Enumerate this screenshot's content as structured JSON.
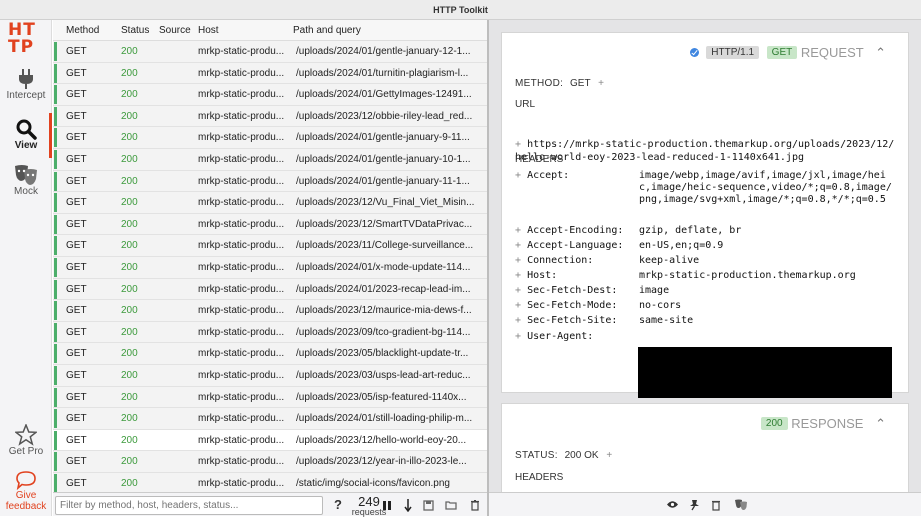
{
  "window": {
    "title": "HTTP Toolkit"
  },
  "app": {
    "logo_line1": "HT",
    "logo_line2": "TP"
  },
  "nav": {
    "intercept": "Intercept",
    "view": "View",
    "mock": "Mock",
    "get_pro": "Get Pro",
    "feedback_line1": "Give",
    "feedback_line2": "feedback"
  },
  "list": {
    "columns": {
      "method": "Method",
      "status": "Status",
      "source": "Source",
      "host": "Host",
      "path": "Path and query"
    },
    "rows": [
      {
        "method": "GET",
        "status": "200",
        "host": "mrkp-static-produ...",
        "path": "/uploads/2024/01/gentle-january-12-1..."
      },
      {
        "method": "GET",
        "status": "200",
        "host": "mrkp-static-produ...",
        "path": "/uploads/2024/01/turnitin-plagiarism-l..."
      },
      {
        "method": "GET",
        "status": "200",
        "host": "mrkp-static-produ...",
        "path": "/uploads/2024/01/GettyImages-12491..."
      },
      {
        "method": "GET",
        "status": "200",
        "host": "mrkp-static-produ...",
        "path": "/uploads/2023/12/obbie-riley-lead_red..."
      },
      {
        "method": "GET",
        "status": "200",
        "host": "mrkp-static-produ...",
        "path": "/uploads/2024/01/gentle-january-9-11..."
      },
      {
        "method": "GET",
        "status": "200",
        "host": "mrkp-static-produ...",
        "path": "/uploads/2024/01/gentle-january-10-1..."
      },
      {
        "method": "GET",
        "status": "200",
        "host": "mrkp-static-produ...",
        "path": "/uploads/2024/01/gentle-january-11-1..."
      },
      {
        "method": "GET",
        "status": "200",
        "host": "mrkp-static-produ...",
        "path": "/uploads/2023/12/Vu_Final_Viet_Misin..."
      },
      {
        "method": "GET",
        "status": "200",
        "host": "mrkp-static-produ...",
        "path": "/uploads/2023/12/SmartTVDataPrivac..."
      },
      {
        "method": "GET",
        "status": "200",
        "host": "mrkp-static-produ...",
        "path": "/uploads/2023/11/College-surveillance..."
      },
      {
        "method": "GET",
        "status": "200",
        "host": "mrkp-static-produ...",
        "path": "/uploads/2024/01/x-mode-update-114..."
      },
      {
        "method": "GET",
        "status": "200",
        "host": "mrkp-static-produ...",
        "path": "/uploads/2024/01/2023-recap-lead-im..."
      },
      {
        "method": "GET",
        "status": "200",
        "host": "mrkp-static-produ...",
        "path": "/uploads/2023/12/maurice-mia-dews-f..."
      },
      {
        "method": "GET",
        "status": "200",
        "host": "mrkp-static-produ...",
        "path": "/uploads/2023/09/tco-gradient-bg-114..."
      },
      {
        "method": "GET",
        "status": "200",
        "host": "mrkp-static-produ...",
        "path": "/uploads/2023/05/blacklight-update-tr..."
      },
      {
        "method": "GET",
        "status": "200",
        "host": "mrkp-static-produ...",
        "path": "/uploads/2023/03/usps-lead-art-reduc..."
      },
      {
        "method": "GET",
        "status": "200",
        "host": "mrkp-static-produ...",
        "path": "/uploads/2023/05/isp-featured-1140x..."
      },
      {
        "method": "GET",
        "status": "200",
        "host": "mrkp-static-produ...",
        "path": "/uploads/2024/01/still-loading-philip-m..."
      },
      {
        "method": "GET",
        "status": "200",
        "host": "mrkp-static-produ...",
        "path": "/uploads/2023/12/hello-world-eoy-20..."
      },
      {
        "method": "GET",
        "status": "200",
        "host": "mrkp-static-produ...",
        "path": "/uploads/2023/12/year-in-illo-2023-le..."
      },
      {
        "method": "GET",
        "status": "200",
        "host": "mrkp-static-produ...",
        "path": "/static/img/social-icons/favicon.png"
      }
    ],
    "selected_index": 18
  },
  "footer": {
    "filter_placeholder": "Filter by method, host, headers, status...",
    "help": "?",
    "count": "249",
    "count_label": "requests"
  },
  "request": {
    "protocol": "HTTP/1.1",
    "method_badge": "GET",
    "title": "REQUEST",
    "method_label": "METHOD:",
    "method_value": "GET",
    "url_label": "URL",
    "url": "https://mrkp-static-production.themarkup.org/uploads/2023/12/hello-world-eoy-2023-lead-reduced-1-1140x641.jpg",
    "headers_label": "HEADERS",
    "headers": [
      {
        "k": "Accept:",
        "v": "image/webp,image/avif,image/jxl,image/heic,image/heic-sequence,video/*;q=0.8,image/png,image/svg+xml,image/*;q=0.8,*/*;q=0.5"
      },
      {
        "k": "Accept-Encoding:",
        "v": "gzip, deflate, br"
      },
      {
        "k": "Accept-Language:",
        "v": "en-US,en;q=0.9"
      },
      {
        "k": "Connection:",
        "v": "keep-alive"
      },
      {
        "k": "Host:",
        "v": "mrkp-static-production.themarkup.org"
      },
      {
        "k": "Sec-Fetch-Dest:",
        "v": "image"
      },
      {
        "k": "Sec-Fetch-Mode:",
        "v": "no-cors"
      },
      {
        "k": "Sec-Fetch-Site:",
        "v": "same-site"
      },
      {
        "k": "User-Agent:",
        "v": ""
      }
    ]
  },
  "response": {
    "status_badge": "200",
    "title": "RESPONSE",
    "status_label": "STATUS:",
    "status_value": "200 OK",
    "headers_label": "HEADERS"
  },
  "colors": {
    "accent": "#e1421f",
    "success": "#4cae6a",
    "source": "#3f86e0"
  }
}
